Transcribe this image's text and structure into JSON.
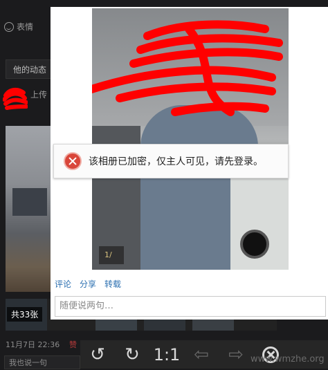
{
  "left": {
    "emoji_label": "表情",
    "dynamics_tab": "他的动态",
    "upload_text": "上传",
    "photo_count": "共33张",
    "timestamp": "11月7日 22:36",
    "like_text": "赞",
    "reply_placeholder": "我也说一句"
  },
  "popup": {
    "alert_message": "该相册已加密，仅主人可见，请先登录。",
    "pager": "1/",
    "actions": [
      "评论",
      "分享",
      "转载"
    ],
    "comment_placeholder": "随便说两句…"
  },
  "toolbar": {
    "actual_size": "1:1",
    "icons": [
      "rotate-left-icon",
      "rotate-right-icon",
      "actual-size",
      "prev-arrow-icon",
      "next-arrow-icon",
      "close-circle-icon"
    ]
  },
  "watermark": "www.wmzhe.org",
  "colors": {
    "link": "#2b6fb0",
    "error": "#d9463a",
    "redaction": "#ff0000"
  }
}
